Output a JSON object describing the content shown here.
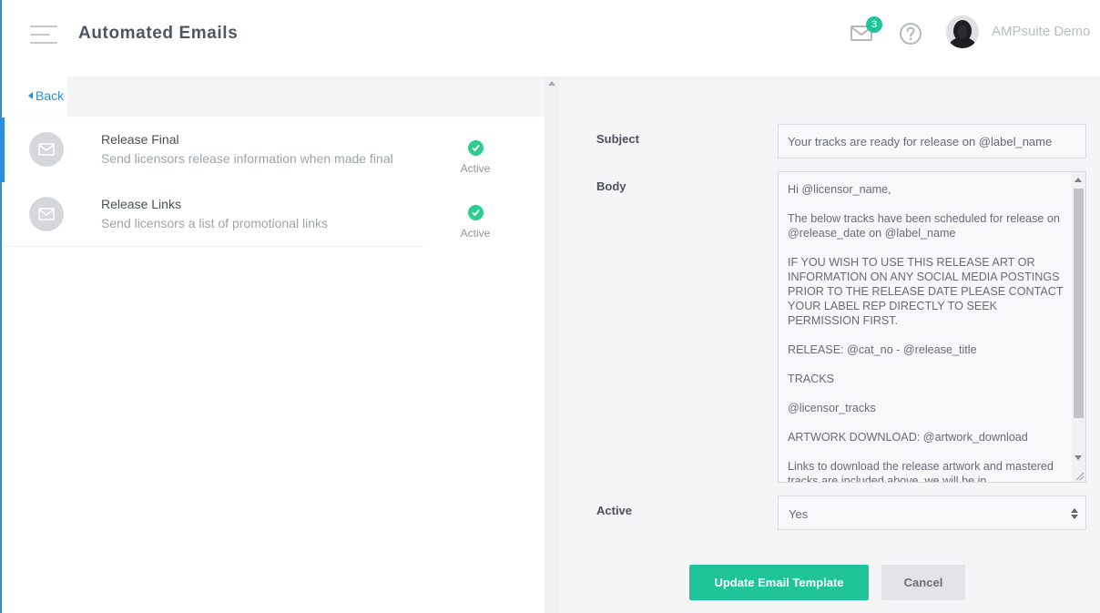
{
  "header": {
    "title": "Automated Emails",
    "notification_count": "3",
    "user_name": "AMPsuite Demo"
  },
  "left": {
    "back_label": "Back",
    "items": [
      {
        "title": "Release Final",
        "description": "Send licensors release information when made final",
        "status": "Active"
      },
      {
        "title": "Release Links",
        "description": "Send licensors a list of promotional links",
        "status": "Active"
      }
    ]
  },
  "form": {
    "subject_label": "Subject",
    "subject_value": "Your tracks are ready for release on @label_name",
    "body_label": "Body",
    "body_value": "Hi @licensor_name,\n\nThe below tracks have been scheduled for release on @release_date on @label_name\n\nIF YOU WISH TO USE THIS RELEASE ART OR INFORMATION ON ANY SOCIAL MEDIA POSTINGS PRIOR TO THE RELEASE DATE PLEASE CONTACT YOUR LABEL REP DIRECTLY TO SEEK PERMISSION FIRST.\n\nRELEASE: @cat_no - @release_title\n\nTRACKS\n\n@licensor_tracks\n\nARTWORK DOWNLOAD: @artwork_download\n\nLinks to download the release artwork and mastered tracks are included above, we will be in",
    "active_label": "Active",
    "active_value": "Yes",
    "update_button": "Update Email Template",
    "cancel_button": "Cancel"
  },
  "colors": {
    "accent_blue": "#2a8fd8",
    "primary_green": "#1fc598",
    "status_green": "#2ecc8f"
  },
  "icons": {
    "menu": "hamburger-icon",
    "mail": "envelope-icon",
    "help": "question-circle-icon",
    "status": "check-circle-icon"
  }
}
